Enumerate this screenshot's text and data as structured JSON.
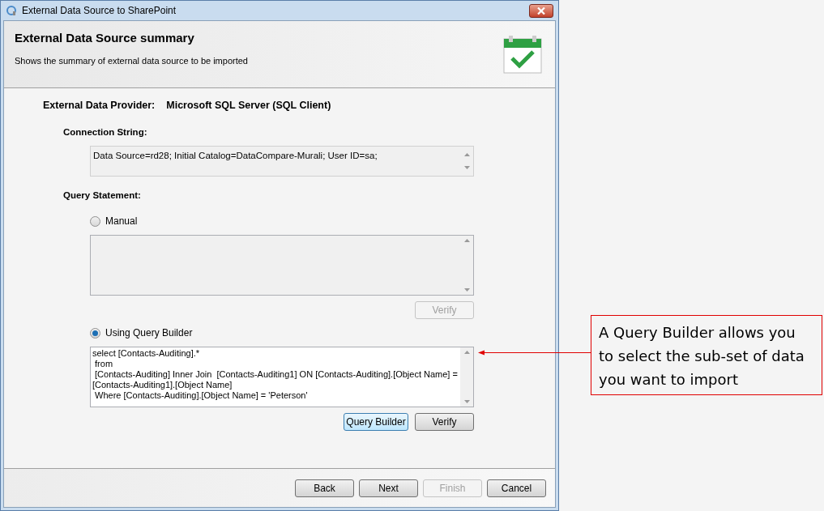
{
  "window": {
    "title": "External Data Source to SharePoint"
  },
  "header": {
    "title": "External Data Source summary",
    "subtitle": "Shows the summary of external data source to be imported"
  },
  "provider": {
    "label": "External Data Provider:",
    "value": "Microsoft SQL Server (SQL Client)"
  },
  "connection": {
    "label": "Connection String:",
    "value": "Data Source=rd28; Initial Catalog=DataCompare-Murali; User ID=sa;"
  },
  "query": {
    "label": "Query Statement:",
    "options": [
      {
        "label": "Manual",
        "selected": false,
        "buttons": [
          {
            "label": "Verify",
            "disabled": true
          }
        ]
      },
      {
        "label": "Using Query Builder",
        "selected": true,
        "lines": [
          "select [Contacts-Auditing].*",
          " from",
          " [Contacts-Auditing] Inner Join  [Contacts-Auditing1] ON [Contacts-Auditing].[Object Name] =",
          "[Contacts-Auditing1].[Object Name]",
          " Where [Contacts-Auditing].[Object Name] = 'Peterson'"
        ],
        "buttons": [
          {
            "label": "Query Builder",
            "disabled": false,
            "focused": true
          },
          {
            "label": "Verify",
            "disabled": false
          }
        ]
      }
    ]
  },
  "footer_buttons": [
    {
      "label": "Back",
      "disabled": false
    },
    {
      "label": "Next",
      "disabled": false
    },
    {
      "label": "Finish",
      "disabled": true
    },
    {
      "label": "Cancel",
      "disabled": false
    }
  ],
  "callout": {
    "text": "A Query Builder allows you to select the sub-set of data you want to import"
  }
}
